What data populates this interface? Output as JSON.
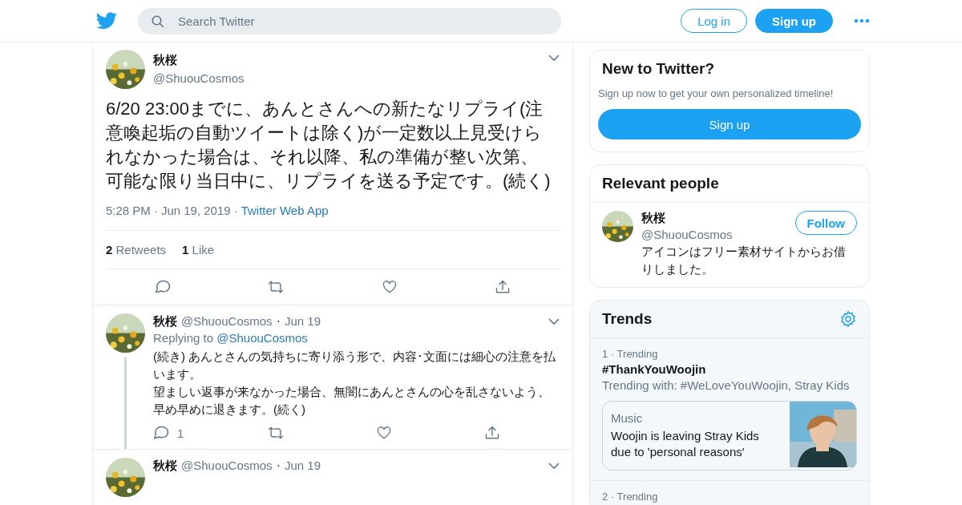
{
  "header": {
    "search": {
      "placeholder": "Search Twitter"
    },
    "login": "Log in",
    "signup": "Sign up"
  },
  "main_tweet": {
    "name": "秋桜",
    "handle": "@ShuouCosmos",
    "text": "6/20 23:00までに、あんとさんへの新たなリプライ(注意喚起垢の自動ツイートは除く)が一定数以上見受けられなかった場合は、それ以降、私の準備が整い次第、可能な限り当日中に、リプライを送る予定です。(続く)",
    "time": "5:28 PM",
    "separators": [
      "·",
      "·"
    ],
    "date": "Jun 19, 2019",
    "source": "Twitter Web App",
    "stats": [
      {
        "count": "2",
        "label": "Retweets"
      },
      {
        "count": "1",
        "label": "Like"
      }
    ]
  },
  "replies": [
    {
      "name": "秋桜",
      "handle": "@ShuouCosmos",
      "separator": "·",
      "date": "Jun 19",
      "replying_label": "Replying to",
      "replying_to": "@ShuouCosmos",
      "paragraphs": [
        "(続き) あんとさんの気持ちに寄り添う形で、内容･文面には細心の注意を払います。",
        "望ましい返事が来なかった場合、無闇にあんとさんの心を乱さないよう、早め早めに退きます。(続く)"
      ],
      "reply_count": "1",
      "thread": true
    },
    {
      "name": "秋桜",
      "handle": "@ShuouCosmos",
      "separator": "·",
      "date": "Jun 19",
      "thread": false
    }
  ],
  "signup_card": {
    "title": "New to Twitter?",
    "text": "Sign up now to get your own personalized timeline!",
    "button": "Sign up"
  },
  "relevant_people": {
    "title": "Relevant people",
    "people": [
      {
        "name": "秋桜",
        "handle": "@ShuouCosmos",
        "bio": "アイコンはフリー素材サイトからお借りしました。",
        "follow": "Follow"
      }
    ]
  },
  "trends": {
    "title": "Trends",
    "items": [
      {
        "rank": "1",
        "separator": "·",
        "label": "Trending",
        "name": "#ThankYouWoojin",
        "with": "Trending with: #WeLoveYouWoojin, Stray Kids",
        "card": {
          "category": "Music",
          "headline": "Woojin is leaving Stray Kids due to 'personal reasons'",
          "kind": "picture"
        }
      },
      {
        "rank": "2",
        "separator": "·",
        "label": "Trending"
      }
    ]
  }
}
